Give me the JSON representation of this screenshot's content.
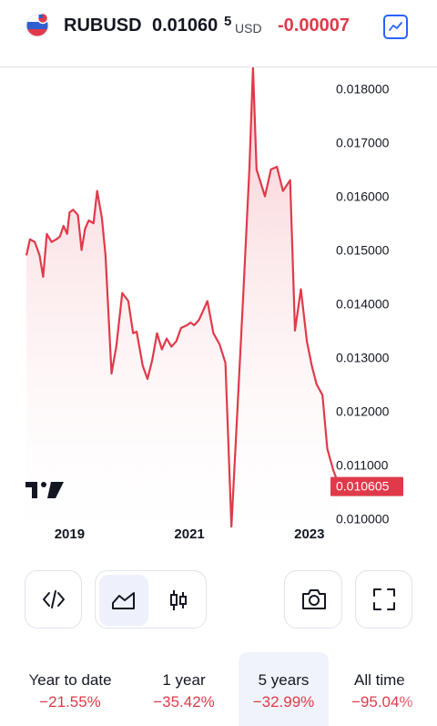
{
  "header": {
    "flag_icon": "russia-us-flag-icon",
    "symbol": "RUBUSD",
    "price": "0.01060",
    "price_superscript": "5",
    "currency": "USD",
    "change": "-0.00007",
    "chart_type_icon": "line-chart-icon"
  },
  "colors": {
    "line": "#e03a4a",
    "area_top": "#f7c6cb",
    "accent": "#2962ff",
    "negative": "#e03a4a",
    "price_tag_bg": "#e03a4a"
  },
  "chart_data": {
    "type": "area",
    "title": "",
    "xlabel": "",
    "ylabel": "",
    "x": [
      2018.28,
      2018.34,
      2018.42,
      2018.5,
      2018.56,
      2018.62,
      2018.7,
      2018.78,
      2018.84,
      2018.9,
      2018.96,
      2019.0,
      2019.06,
      2019.14,
      2019.2,
      2019.26,
      2019.32,
      2019.4,
      2019.46,
      2019.54,
      2019.6,
      2019.7,
      2019.78,
      2019.88,
      2019.98,
      2020.06,
      2020.12,
      2020.22,
      2020.3,
      2020.38,
      2020.46,
      2020.54,
      2020.62,
      2020.7,
      2020.78,
      2020.86,
      2020.96,
      2021.02,
      2021.08,
      2021.16,
      2021.22,
      2021.3,
      2021.4,
      2021.5,
      2021.6,
      2021.7,
      2021.8,
      2021.9,
      2022.0,
      2022.06,
      2022.12,
      2022.26,
      2022.36,
      2022.46,
      2022.56,
      2022.68,
      2022.76,
      2022.86,
      2022.96,
      2023.04,
      2023.12,
      2023.22,
      2023.3,
      2023.4,
      2023.5,
      2023.6,
      2023.7,
      2023.8,
      2023.9
    ],
    "values": [
      0.0149,
      0.0152,
      0.01515,
      0.0149,
      0.0145,
      0.0153,
      0.01515,
      0.0152,
      0.01525,
      0.01545,
      0.0153,
      0.0157,
      0.01575,
      0.01565,
      0.015,
      0.0154,
      0.01555,
      0.0155,
      0.0161,
      0.0156,
      0.0149,
      0.0127,
      0.0132,
      0.0142,
      0.01405,
      0.01345,
      0.01348,
      0.01285,
      0.0126,
      0.01295,
      0.01345,
      0.01315,
      0.01335,
      0.0132,
      0.0133,
      0.01355,
      0.0136,
      0.01365,
      0.0136,
      0.0137,
      0.01385,
      0.01405,
      0.01345,
      0.01325,
      0.0129,
      0.00985,
      0.012,
      0.0142,
      0.0165,
      0.0184,
      0.0165,
      0.016,
      0.0165,
      0.01655,
      0.0161,
      0.0163,
      0.0135,
      0.01427,
      0.0133,
      0.01285,
      0.0125,
      0.0123,
      0.0113,
      0.0109,
      0.0106,
      0.0106,
      0.0106,
      0.0106,
      0.0106
    ],
    "last_value": 0.010605,
    "last_value_label": "0.010605",
    "xlim": [
      2018.25,
      2024.05
    ],
    "ylim": [
      0.00975,
      0.0184
    ],
    "y_ticks": [
      "0.010000",
      "0.011000",
      "0.012000",
      "0.013000",
      "0.014000",
      "0.015000",
      "0.016000",
      "0.017000",
      "0.018000"
    ],
    "y_tick_values": [
      0.01,
      0.011,
      0.012,
      0.013,
      0.014,
      0.015,
      0.016,
      0.017,
      0.018
    ],
    "x_ticks": [
      "2019",
      "2021",
      "2023"
    ],
    "x_tick_values": [
      2019.0,
      2021.0,
      2023.0
    ],
    "grid": false,
    "legend": "none"
  },
  "watermark": "tradingview-logo",
  "toolbar": {
    "embed_icon": "code-embed-icon",
    "area_icon": "area-chart-icon",
    "candles_icon": "candlestick-icon",
    "snapshot_icon": "camera-icon",
    "fullscreen_icon": "fullscreen-icon"
  },
  "periods": [
    {
      "label": "Year to date",
      "value": "−21.55%"
    },
    {
      "label": "1 year",
      "value": "−35.42%"
    },
    {
      "label": "5 years",
      "value": "−32.99%"
    },
    {
      "label": "All time",
      "value": "−95.04%"
    }
  ],
  "active_period": "5 years"
}
